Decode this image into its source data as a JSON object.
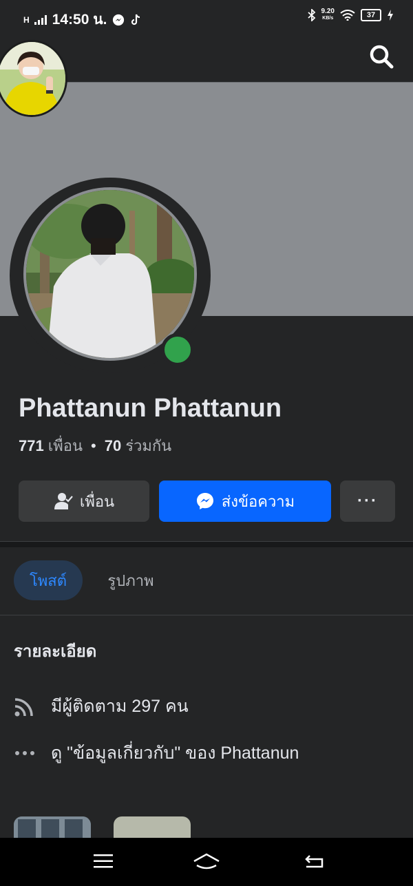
{
  "status_bar": {
    "signal": "H",
    "time": "14:50 น.",
    "speed_value": "9.20",
    "speed_unit": "KB/s",
    "battery": "37"
  },
  "profile": {
    "name": "Phattanun Phattanun",
    "friends_count": "771",
    "friends_label": "เพื่อน",
    "separator": "•",
    "mutual_count": "70",
    "mutual_label": "ร่วมกัน"
  },
  "actions": {
    "friend_label": "เพื่อน",
    "message_label": "ส่งข้อความ",
    "more_label": "···"
  },
  "tabs": [
    {
      "label": "โพสต์",
      "active": true
    },
    {
      "label": "รูปภาพ",
      "active": false
    }
  ],
  "details": {
    "title": "รายละเอียด",
    "followers": "มีผู้ติดตาม 297 คน",
    "about": "ดู \"ข้อมูลเกี่ยวกับ\" ของ Phattanun"
  },
  "icons": {
    "search": "search-icon",
    "friend": "person-check-icon",
    "messenger": "messenger-icon",
    "more": "more-dots-icon",
    "followers": "rss-icon",
    "about": "ellipsis-icon",
    "nav_menu": "menu-icon",
    "nav_home": "home-icon",
    "nav_back": "back-icon"
  },
  "colors": {
    "background": "#242526",
    "cover": "#8a8d91",
    "primary": "#0866ff",
    "online": "#31a24c",
    "tab_active_bg": "#263951",
    "tab_active_text": "#2d88ff"
  }
}
